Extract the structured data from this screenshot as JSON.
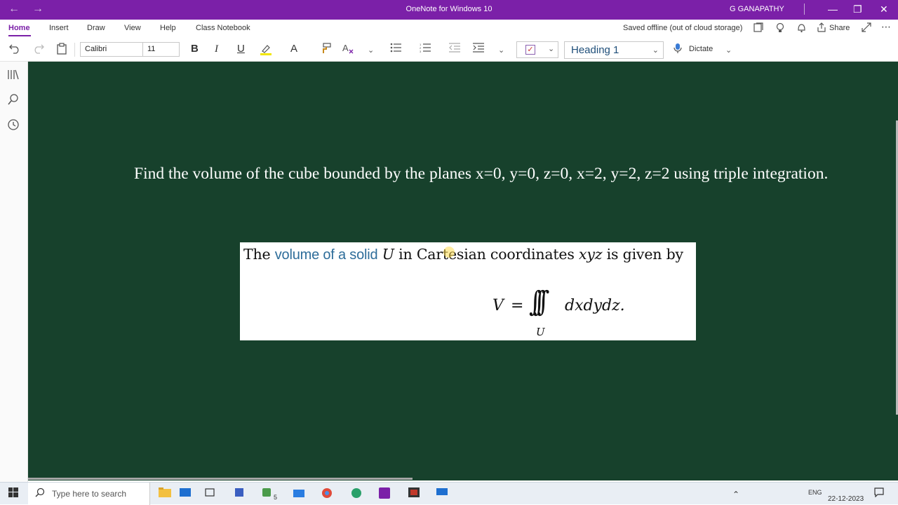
{
  "window": {
    "title": "OneNote for Windows 10",
    "user": "G GANAPATHY",
    "nav_back": "←",
    "nav_forward": "→",
    "minimize": "—",
    "restore": "❐",
    "close": "✕"
  },
  "ribbon": {
    "tabs": [
      "Home",
      "Insert",
      "Draw",
      "View",
      "Help",
      "Class Notebook"
    ],
    "active_tab": "Home",
    "status": "Saved offline (out of cloud storage)",
    "share_label": "Share",
    "more": "⋯"
  },
  "toolbar": {
    "font_name": "Calibri",
    "font_size": "11",
    "bold": "B",
    "italic": "I",
    "underline": "U",
    "font_color": "A",
    "style": "Heading 1",
    "dictate_label": "Dictate",
    "tag_checkmark": "✓"
  },
  "page": {
    "question": "Find the volume of the cube bounded by the planes x=0, y=0, z=0, x=2, y=2, z=2 using triple integration."
  },
  "embedded_image": {
    "text_before": "The ",
    "link_text": "volume of a solid",
    "text_u": " U",
    "text_middle": " in Cartesian coordinates ",
    "text_xyz": "xyz",
    "text_after": " is given by",
    "formula_v": "V",
    "formula_eq": "=",
    "formula_integral": "∫∫∫",
    "formula_sub": "U",
    "formula_integrand": "dxdydz."
  },
  "taskbar": {
    "search_placeholder": "Type here to search",
    "badge_count": "5",
    "language": "ENG",
    "date": "22-12-2023"
  },
  "colors": {
    "titlebar": "#7b20a8",
    "canvas": "#17412c",
    "link": "#2e6d9a",
    "heading_style": "#1e4e79"
  }
}
